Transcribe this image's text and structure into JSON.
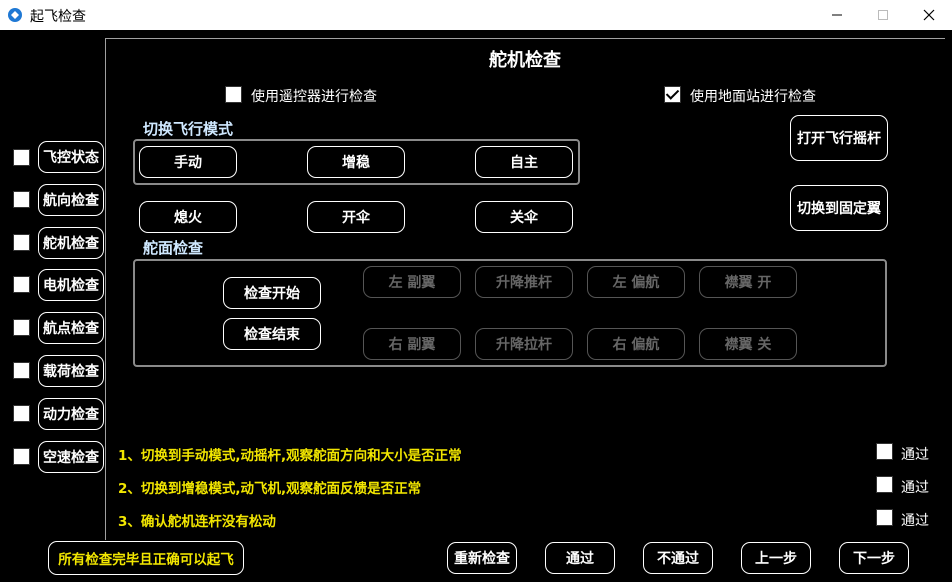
{
  "window": {
    "title": "起飞检查"
  },
  "panel": {
    "title": "舵机检查",
    "use_remote_label": "使用遥控器进行检查",
    "use_remote_checked": false,
    "use_ground_label": "使用地面站进行检查",
    "use_ground_checked": true
  },
  "flight_mode": {
    "section_label": "切换飞行模式",
    "buttons": [
      "手动",
      "增稳",
      "自主"
    ]
  },
  "actions_row": [
    "熄火",
    "开伞",
    "关伞"
  ],
  "right_buttons": {
    "open_stick": "打开飞行摇杆",
    "switch_fixed_wing": "切换到固定翼"
  },
  "rudder": {
    "section_label": "舵面检查",
    "start": "检查开始",
    "end": "检查结束",
    "top_row": [
      "左 副翼",
      "升降推杆",
      "左 偏航",
      "襟翼 开"
    ],
    "bottom_row": [
      "右 副翼",
      "升降拉杆",
      "右 偏航",
      "襟翼 关"
    ]
  },
  "sidebar": {
    "items": [
      {
        "label": "飞控状态",
        "checked": false
      },
      {
        "label": "航向检查",
        "checked": false
      },
      {
        "label": "舵机检查",
        "checked": false
      },
      {
        "label": "电机检查",
        "checked": false
      },
      {
        "label": "航点检查",
        "checked": false
      },
      {
        "label": "载荷检查",
        "checked": false
      },
      {
        "label": "动力检查",
        "checked": false
      },
      {
        "label": "空速检查",
        "checked": false
      }
    ]
  },
  "notes": [
    "1、切换到手动模式,动摇杆,观察舵面方向和大小是否正常",
    "2、切换到增稳模式,动飞机,观察舵面反馈是否正常",
    "3、确认舵机连杆没有松动"
  ],
  "pass_label": "通过",
  "footer": {
    "final_note": "所有检查完毕且正确可以起飞",
    "recheck": "重新检查",
    "pass": "通过",
    "fail": "不通过",
    "prev": "上一步",
    "next": "下一步"
  }
}
